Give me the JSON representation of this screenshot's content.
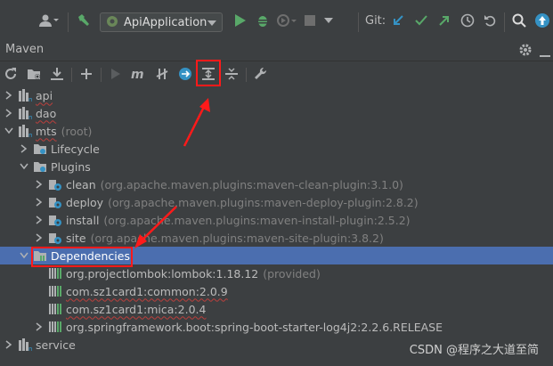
{
  "toolbar_top": {
    "run_config": "ApiApplication",
    "git_label": "Git:"
  },
  "panel": {
    "title": "Maven"
  },
  "tree": [
    {
      "name": "api",
      "desc": "",
      "depth": 0,
      "expanded": false,
      "icon": "maven-module-icon",
      "underline": true
    },
    {
      "name": "dao",
      "desc": "",
      "depth": 0,
      "expanded": false,
      "icon": "maven-module-icon",
      "underline": true
    },
    {
      "name": "mts",
      "desc": "(root)",
      "depth": 0,
      "expanded": true,
      "icon": "maven-module-icon",
      "underline": true
    },
    {
      "name": "Lifecycle",
      "desc": "",
      "depth": 1,
      "expanded": false,
      "icon": "folder-gear-icon",
      "underline": false
    },
    {
      "name": "Plugins",
      "desc": "",
      "depth": 1,
      "expanded": true,
      "icon": "folder-gear-icon",
      "underline": false
    },
    {
      "name": "clean",
      "desc": "(org.apache.maven.plugins:maven-clean-plugin:3.1.0)",
      "depth": 2,
      "expanded": false,
      "icon": "plugin-icon",
      "underline": false
    },
    {
      "name": "deploy",
      "desc": "(org.apache.maven.plugins:maven-deploy-plugin:2.8.2)",
      "depth": 2,
      "expanded": false,
      "icon": "plugin-icon",
      "underline": false
    },
    {
      "name": "install",
      "desc": "(org.apache.maven.plugins:maven-install-plugin:2.5.2)",
      "depth": 2,
      "expanded": false,
      "icon": "plugin-icon",
      "underline": false
    },
    {
      "name": "site",
      "desc": "(org.apache.maven.plugins:maven-site-plugin:3.8.2)",
      "depth": 2,
      "expanded": false,
      "icon": "plugin-icon",
      "underline": false
    },
    {
      "name": "Dependencies",
      "desc": "",
      "depth": 1,
      "expanded": true,
      "icon": "folder-library-icon",
      "underline": false,
      "selected": true
    },
    {
      "name": "org.projectlombok:lombok:1.18.12",
      "desc": "(provided)",
      "depth": 2,
      "expanded": null,
      "icon": "library-icon",
      "underline": false
    },
    {
      "name": "com.sz1card1:common:2.0.9",
      "desc": "",
      "depth": 2,
      "expanded": null,
      "icon": "library-icon",
      "underline": true
    },
    {
      "name": "com.sz1card1:mica:2.0.4",
      "desc": "",
      "depth": 2,
      "expanded": null,
      "icon": "library-icon",
      "underline": true
    },
    {
      "name": "org.springframework.boot:spring-boot-starter-log4j2:2.2.6.RELEASE",
      "desc": "",
      "depth": 2,
      "expanded": false,
      "icon": "library-icon",
      "underline": false
    },
    {
      "name": "service",
      "desc": "",
      "depth": 0,
      "expanded": false,
      "icon": "maven-module-icon",
      "underline": false
    }
  ],
  "watermark": "CSDN @程序之大道至简",
  "colors": {
    "accent_blue": "#4b6eaf",
    "highlight_red": "#ff1a1a",
    "run_green": "#59a869",
    "bg": "#3c3f41"
  }
}
